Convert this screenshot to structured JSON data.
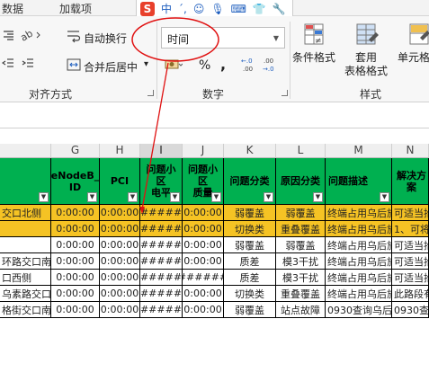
{
  "ribbon": {
    "tabs": [
      "数据",
      "加载项"
    ],
    "alignment": {
      "wrap_label": "自动换行",
      "merge_label": "合并后居中",
      "merge_dropdown": "▾",
      "group_label": "对齐方式"
    },
    "number": {
      "format_value": "时间",
      "percent": "%",
      "comma": ",",
      "group_label": "数字",
      "inc_decimal": "←.0\n.00",
      "dec_decimal": ".00\n→.0"
    },
    "styles": {
      "conditional_label": "条件格式",
      "table_label": "套用\n表格格式",
      "cell_label": "单元格样",
      "group_label": "样式"
    }
  },
  "grid": {
    "columns": [
      "G",
      "H",
      "I",
      "J",
      "K",
      "L",
      "M",
      "N"
    ],
    "selected_column": "I",
    "headers": {
      "F": "",
      "G": "eNodeB_\nID",
      "H": "PCI",
      "I": "问题小\n区\n电平",
      "J": "问题小\n区\n质量",
      "K": "问题分类",
      "L": "原因分类",
      "M": "问题描述",
      "N": "解决方案"
    },
    "rows": [
      {
        "F": "交口北侧",
        "G": "0:00:00",
        "H": "0:00:00",
        "I": "#####",
        "J": "0:00:00",
        "K": "弱覆盖",
        "L": "弱覆盖",
        "M": "终端占用乌后旅",
        "N": "可适当抬",
        "color": "#f5c324"
      },
      {
        "F": "",
        "G": "0:00:00",
        "H": "0:00:00",
        "I": "#####",
        "J": "0:00:00",
        "K": "切换类",
        "L": "重叠覆盖",
        "M": "终端占用乌后旅",
        "N": "1、可将",
        "color": "#f5c324"
      },
      {
        "F": "",
        "G": "0:00:00",
        "H": "0:00:00",
        "I": "#####",
        "J": "0:00:00",
        "K": "弱覆盖",
        "L": "弱覆盖",
        "M": "终端占用乌后旅",
        "N": "可适当抬",
        "color": "#ffffff"
      },
      {
        "F": "环路交口南侧",
        "G": "0:00:00",
        "H": "0:00:00",
        "I": "#####",
        "J": "0:00:00",
        "K": "质差",
        "L": "模3干扰",
        "M": "终端占用乌后旅",
        "N": "可适当抬",
        "color": "#ffffff"
      },
      {
        "F": "口西侧",
        "G": "0:00:00",
        "H": "0:00:00",
        "I": "#####",
        "J": "######",
        "K": "质差",
        "L": "模3干扰",
        "M": "终端占用乌后旅",
        "N": "可适当抬",
        "color": "#ffffff"
      },
      {
        "F": "乌素路交口北",
        "G": "0:00:00",
        "H": "0:00:00",
        "I": "#####",
        "J": "0:00:00",
        "K": "切换类",
        "L": "重叠覆盖",
        "M": "终端占用乌后旅",
        "N": "此路段有",
        "color": "#ffffff"
      },
      {
        "F": "格街交口南侧",
        "G": "0:00:00",
        "H": "0:00:00",
        "I": "#####",
        "J": "0:00:00",
        "K": "弱覆盖",
        "L": "站点故障",
        "M": "0930查询乌后",
        "N": "0930查",
        "color": "#ffffff"
      }
    ]
  },
  "annotation": {
    "color": "#e01010"
  }
}
